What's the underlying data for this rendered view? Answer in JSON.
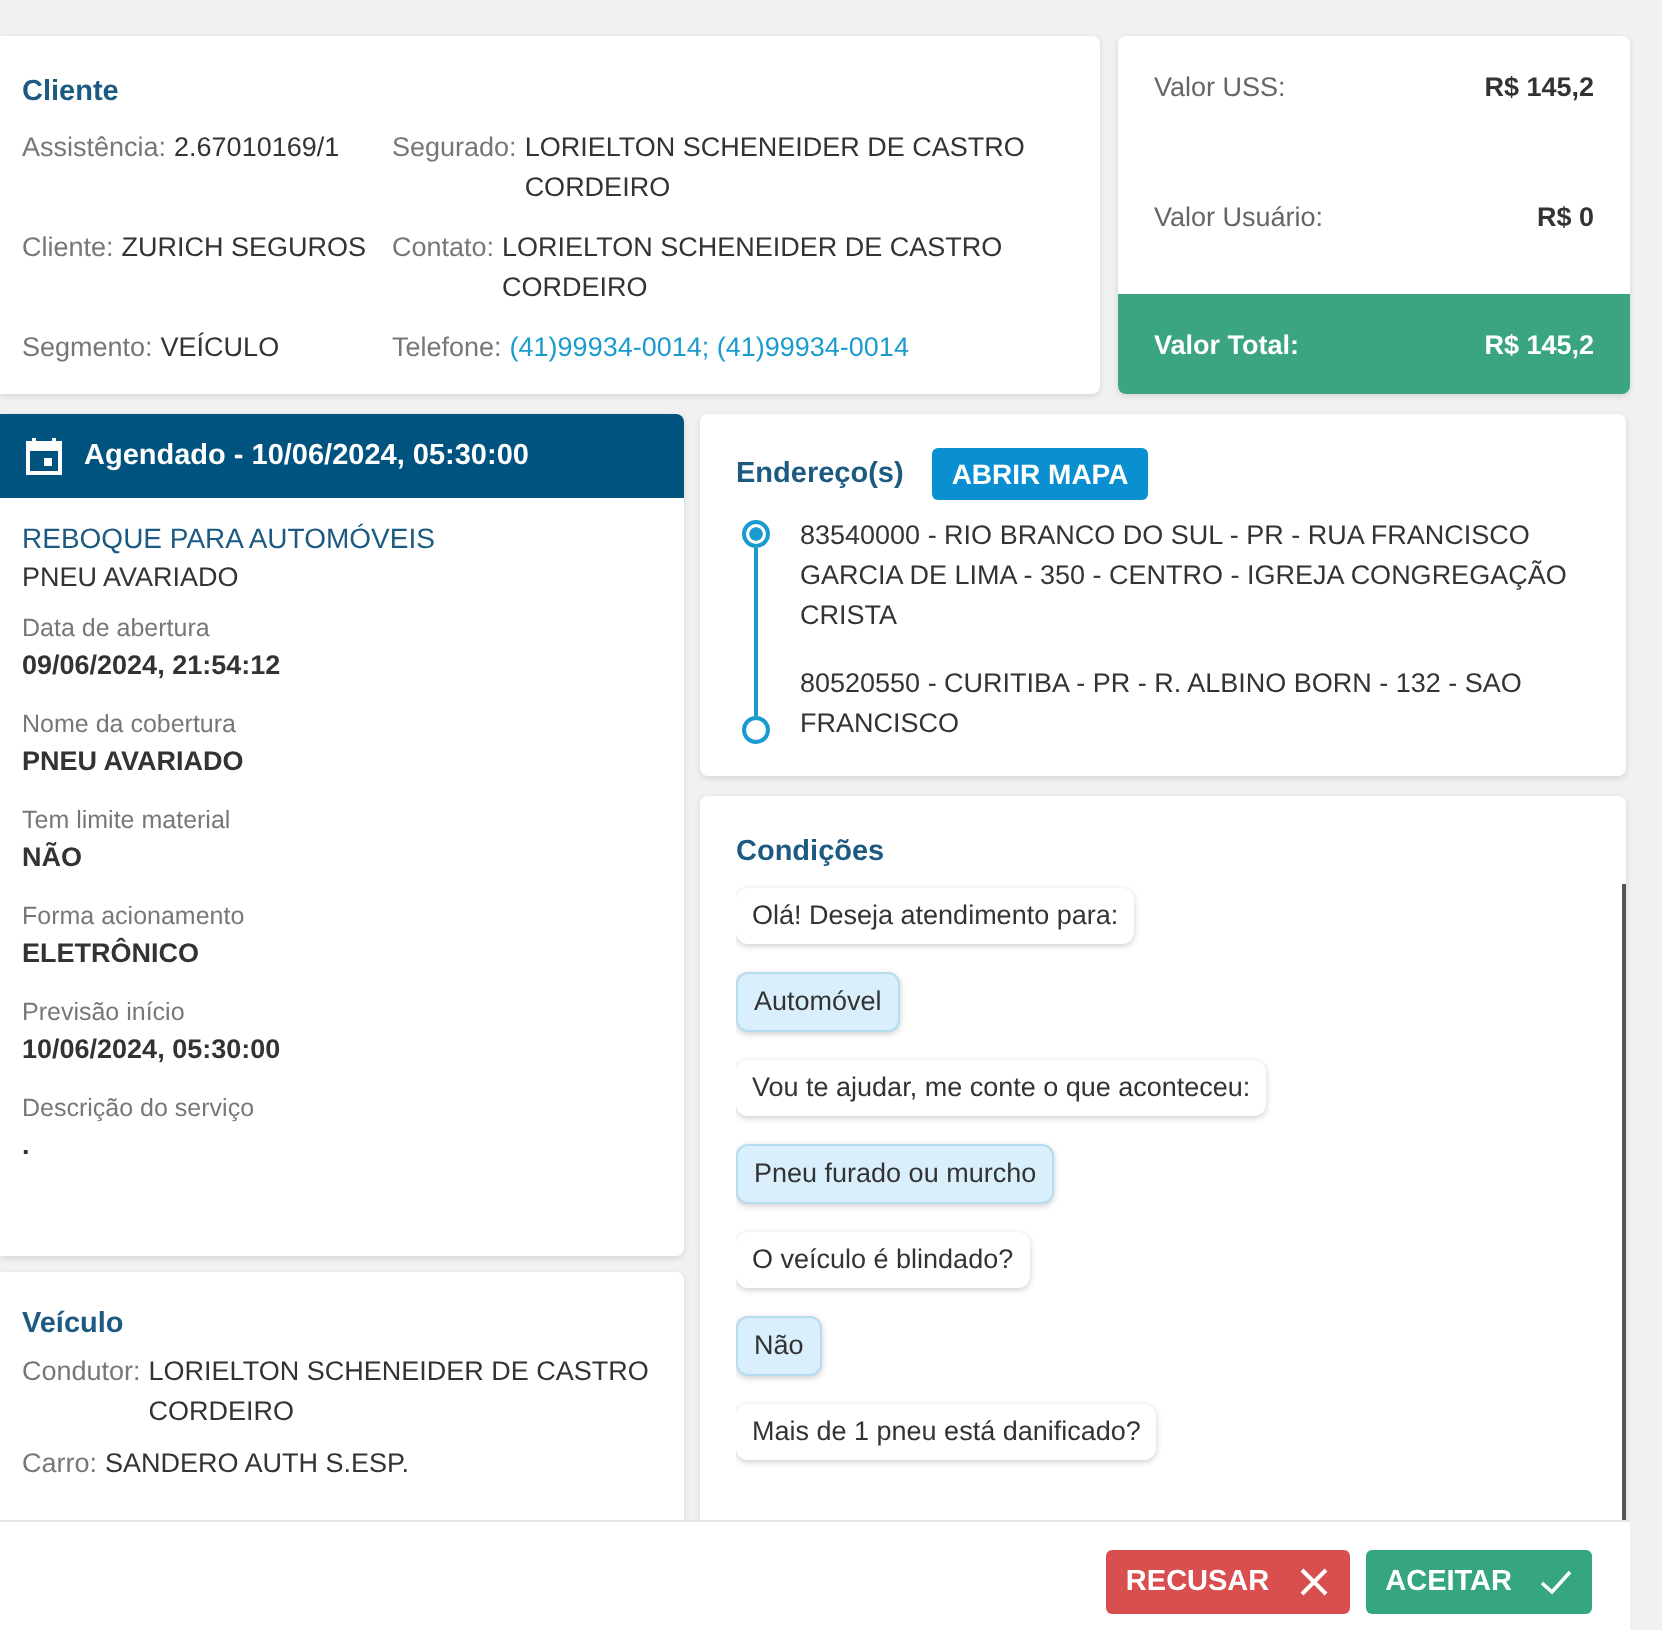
{
  "client": {
    "title": "Cliente",
    "fields": [
      {
        "label": "Assistência:",
        "value": "2.67010169/1",
        "kind": "text"
      },
      {
        "label": "Segurado:",
        "value": "LORIELTON SCHENEIDER DE CASTRO CORDEIRO",
        "kind": "text"
      },
      {
        "label": "Cliente:",
        "value": "ZURICH SEGUROS",
        "kind": "text"
      },
      {
        "label": "Contato:",
        "value": "LORIELTON SCHENEIDER DE CASTRO CORDEIRO",
        "kind": "text"
      },
      {
        "label": "Segmento:",
        "value": "VEÍCULO",
        "kind": "text"
      },
      {
        "label": "Telefone:",
        "value": "(41)99934-0014; (41)99934-0014",
        "kind": "link"
      }
    ]
  },
  "values": [
    {
      "label": "Valor USS:",
      "value": "R$ 145,2",
      "kind": "plain"
    },
    {
      "label": "Valor Usuário:",
      "value": "R$ 0",
      "kind": "plain"
    },
    {
      "label": "Valor Total:",
      "value": "R$ 145,2",
      "kind": "total"
    }
  ],
  "schedule": {
    "header": "Agendado - 10/06/2024, 05:30:00",
    "service": "REBOQUE PARA AUTOMÓVEIS",
    "subtitle": "PNEU AVARIADO",
    "details": [
      {
        "label": "Data de abertura",
        "value": "09/06/2024, 21:54:12"
      },
      {
        "label": "Nome da cobertura",
        "value": "PNEU AVARIADO"
      },
      {
        "label": "Tem limite material",
        "value": "NÃO"
      },
      {
        "label": "Forma acionamento",
        "value": "ELETRÔNICO"
      },
      {
        "label": "Previsão início",
        "value": "10/06/2024, 05:30:00"
      },
      {
        "label": "Descrição do serviço",
        "value": "."
      }
    ]
  },
  "vehicle": {
    "title": "Veículo",
    "fields": [
      {
        "label": "Condutor:",
        "value": "LORIELTON SCHENEIDER DE CASTRO CORDEIRO"
      },
      {
        "label": "Carro:",
        "value": "SANDERO AUTH S.ESP."
      }
    ]
  },
  "addresses": {
    "title": "Endereço(s)",
    "button": "ABRIR MAPA",
    "items": [
      {
        "text": "83540000 - RIO BRANCO DO SUL - PR - RUA FRANCISCO GARCIA DE LIMA - 350 - CENTRO - IGREJA CONGREGAÇÃO CRISTA",
        "kind": "origin"
      },
      {
        "text": "80520550 - CURITIBA - PR - R. ALBINO BORN - 132 - SAO FRANCISCO",
        "kind": "destination"
      }
    ]
  },
  "conditions": {
    "title": "Condições",
    "messages": [
      {
        "text": "Olá! Deseja atendimento para:",
        "kind": "question"
      },
      {
        "text": "Automóvel",
        "kind": "answer"
      },
      {
        "text": "Vou te ajudar, me conte o que aconteceu:",
        "kind": "question"
      },
      {
        "text": "Pneu furado ou murcho",
        "kind": "answer"
      },
      {
        "text": "O veículo é blindado?",
        "kind": "question"
      },
      {
        "text": "Não",
        "kind": "answer"
      },
      {
        "text": "Mais de 1 pneu está danificado?",
        "kind": "question"
      }
    ]
  },
  "footer": {
    "buttons": [
      {
        "label": "RECUSAR",
        "kind": "reject"
      },
      {
        "label": "ACEITAR",
        "kind": "accept"
      }
    ]
  }
}
